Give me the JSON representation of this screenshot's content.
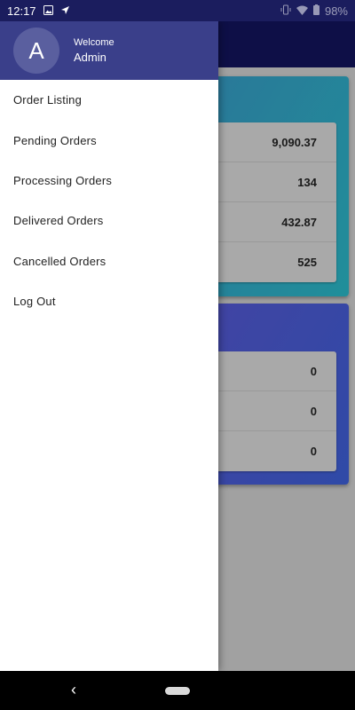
{
  "status_bar": {
    "time": "12:17",
    "battery": "98%",
    "icons": [
      "image-icon",
      "navigation-icon",
      "vibrate-icon",
      "wifi-icon",
      "battery-icon"
    ]
  },
  "drawer": {
    "avatar_letter": "A",
    "welcome": "Welcome",
    "user_name": "Admin",
    "menu": [
      {
        "label": "Order Listing"
      },
      {
        "label": "Pending Orders"
      },
      {
        "label": "Processing Orders"
      },
      {
        "label": "Delivered Orders"
      },
      {
        "label": "Cancelled Orders"
      },
      {
        "label": "Log Out"
      }
    ]
  },
  "background_cards": {
    "card1": [
      "9,090.37",
      "134",
      "432.87",
      "525"
    ],
    "card2": [
      "0",
      "0",
      "0"
    ]
  },
  "colors": {
    "drawer_header": "#3a3f8a",
    "app_bar": "#12145c",
    "card1_gradient": [
      "#3f86c4",
      "#2ab7c6"
    ],
    "card2_gradient": [
      "#6652cf",
      "#3d5fd6"
    ]
  }
}
